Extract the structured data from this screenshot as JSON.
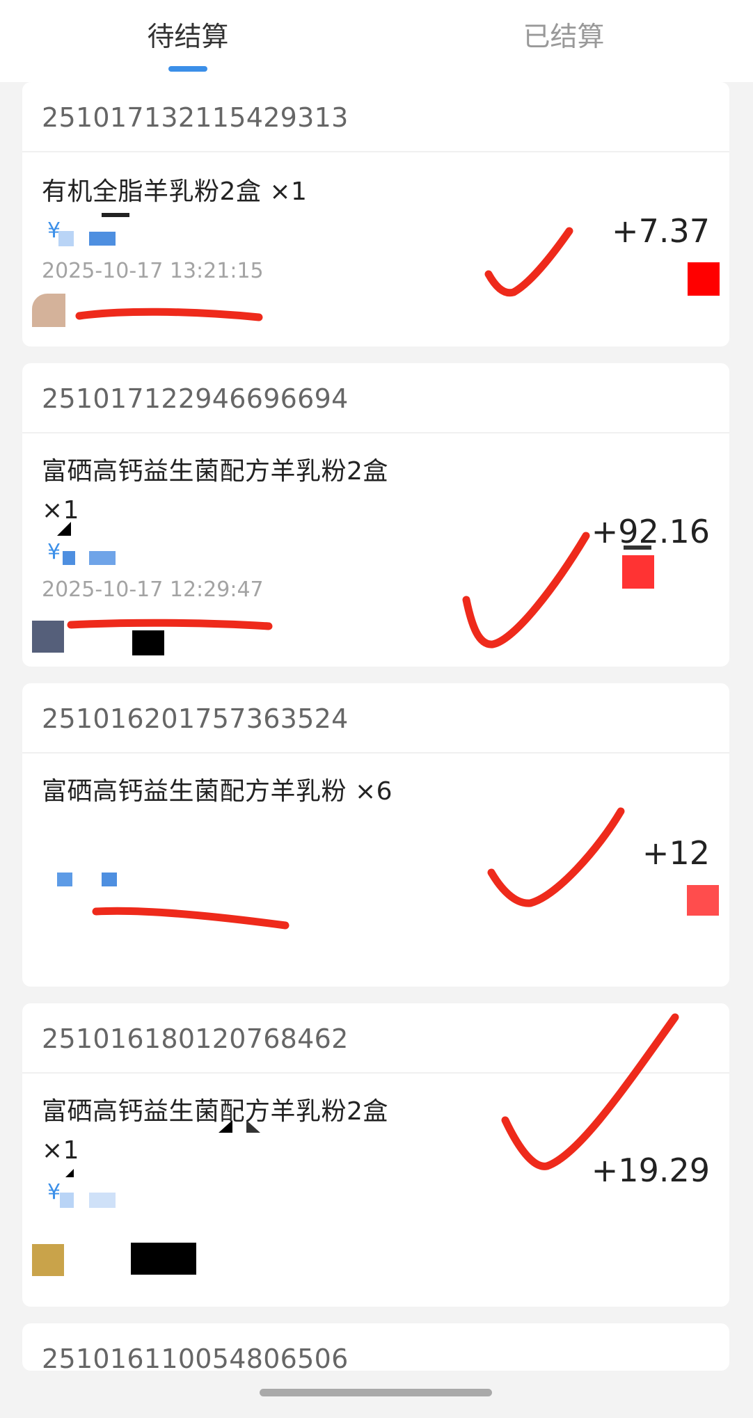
{
  "tabs": {
    "pending_label": "待结算",
    "settled_label": "已结算",
    "active": "pending"
  },
  "orders": [
    {
      "order_no": "251017132115429313",
      "product": "有机全脂羊乳粉2盒 ×1",
      "currency_symbol": "¥",
      "time": "2025-10-17 13:21:15",
      "amount": "+7.37"
    },
    {
      "order_no": "251017122946696694",
      "product": "富硒高钙益生菌配方羊乳粉2盒 ×1",
      "currency_symbol": "¥",
      "time": "2025-10-17 12:29:47",
      "amount": "+92.16"
    },
    {
      "order_no": "251016201757363524",
      "product": "富硒高钙益生菌配方羊乳粉 ×6",
      "currency_symbol": "",
      "time": "",
      "amount": "+12"
    },
    {
      "order_no": "251016180120768462",
      "product": "富硒高钙益生菌配方羊乳粉2盒 ×1",
      "currency_symbol": "¥",
      "time": "",
      "amount": "+19.29"
    },
    {
      "order_no": "251016110054806506"
    }
  ],
  "colors": {
    "accent": "#3b8fe8",
    "annotation_red": "#ee2a1b",
    "redaction_red": "#ff0000"
  }
}
